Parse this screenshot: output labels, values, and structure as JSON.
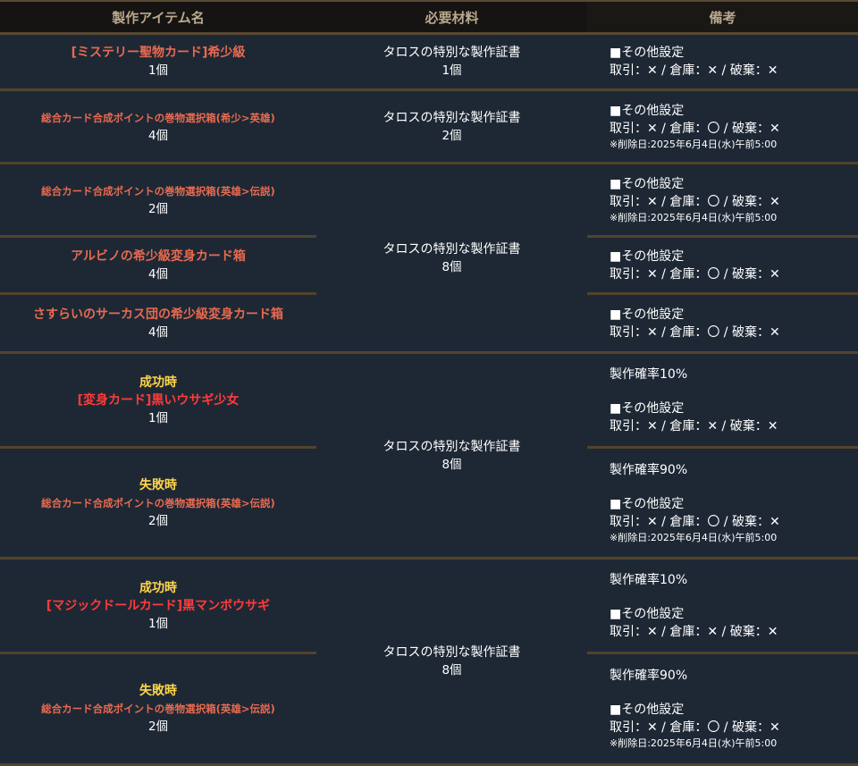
{
  "headers": {
    "item": "製作アイテム名",
    "materials": "必要材料",
    "notes": "備考"
  },
  "rows": [
    {
      "item_name": "[ミステリー聖物カード]希少級",
      "item_qty": "1個",
      "material": "タロスの特別な製作証書",
      "material_qty": "1個",
      "note_head": "■その他設定",
      "note_trade": "取引：✕ / 倉庫：✕ / 破棄：✕"
    },
    {
      "item_name": "総合カード合成ポイントの巻物選択箱(希少>英雄)",
      "item_qty": "4個",
      "material": "タロスの特別な製作証書",
      "material_qty": "2個",
      "note_head": "■その他設定",
      "note_trade": "取引：✕ / 倉庫：〇 / 破棄：✕",
      "note_date": "※削除日:2025年6月4日(水)午前5:00"
    },
    {
      "item_name": "総合カード合成ポイントの巻物選択箱(英雄>伝説)",
      "item_qty": "2個",
      "note_head": "■その他設定",
      "note_trade": "取引：✕ / 倉庫：〇 / 破棄：✕",
      "note_date": "※削除日:2025年6月4日(水)午前5:00"
    },
    {
      "item_name": "アルビノの希少級変身カード箱",
      "item_qty": "4個",
      "note_head": "■その他設定",
      "note_trade": "取引：✕ / 倉庫：〇 / 破棄：✕"
    },
    {
      "item_name": "さすらいのサーカス団の希少級変身カード箱",
      "item_qty": "4個",
      "note_head": "■その他設定",
      "note_trade": "取引：✕ / 倉庫：〇 / 破棄：✕"
    },
    {
      "item_status": "成功時",
      "item_name": "[変身カード]黒いウサギ少女",
      "item_qty": "1個",
      "note_rate": "製作確率10%",
      "note_head": "■その他設定",
      "note_trade": "取引：✕ / 倉庫：✕ / 破棄：✕"
    },
    {
      "item_status": "失敗時",
      "item_name": "総合カード合成ポイントの巻物選択箱(英雄>伝説)",
      "item_qty": "2個",
      "note_rate": "製作確率90%",
      "note_head": "■その他設定",
      "note_trade": "取引：✕ / 倉庫：〇 / 破棄：✕",
      "note_date": "※削除日:2025年6月4日(水)午前5:00"
    },
    {
      "item_status": "成功時",
      "item_name": "[マジックドールカード]黒マンボウサギ",
      "item_qty": "1個",
      "note_rate": "製作確率10%",
      "note_head": "■その他設定",
      "note_trade": "取引：✕ / 倉庫：✕ / 破棄：✕"
    },
    {
      "item_status": "失敗時",
      "item_name": "総合カード合成ポイントの巻物選択箱(英雄>伝説)",
      "item_qty": "2個",
      "note_rate": "製作確率90%",
      "note_head": "■その他設定",
      "note_trade": "取引：✕ / 倉庫：〇 / 破棄：✕",
      "note_date": "※削除日:2025年6月4日(水)午前5:00"
    }
  ],
  "material_groups": [
    {
      "material": "タロスの特別な製作証書",
      "material_qty": "8個"
    },
    {
      "material": "タロスの特別な製作証書",
      "material_qty": "8個"
    },
    {
      "material": "タロスの特別な製作証書",
      "material_qty": "8個"
    }
  ]
}
